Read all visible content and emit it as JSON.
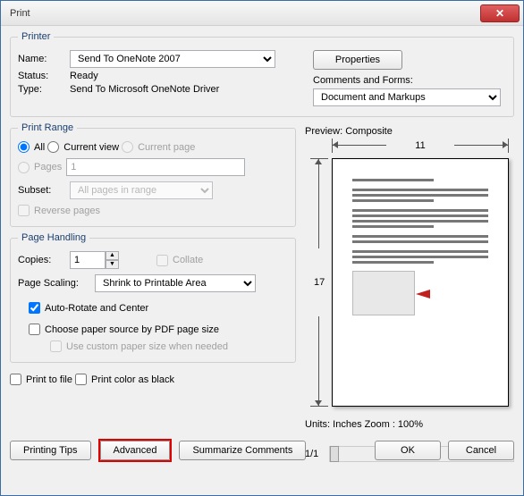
{
  "window": {
    "title": "Print"
  },
  "printer": {
    "legend": "Printer",
    "name_label": "Name:",
    "name_value": "Send To OneNote 2007",
    "properties_btn": "Properties",
    "status_label": "Status:",
    "status_value": "Ready",
    "type_label": "Type:",
    "type_value": "Send To Microsoft OneNote Driver",
    "comments_label": "Comments and Forms:",
    "comments_value": "Document and Markups"
  },
  "range": {
    "legend": "Print Range",
    "all": "All",
    "current_view": "Current view",
    "current_page": "Current page",
    "pages": "Pages",
    "pages_value": "1",
    "subset_label": "Subset:",
    "subset_value": "All pages in range",
    "reverse": "Reverse pages"
  },
  "handling": {
    "legend": "Page Handling",
    "copies_label": "Copies:",
    "copies_value": "1",
    "collate": "Collate",
    "scaling_label": "Page Scaling:",
    "scaling_value": "Shrink to Printable Area",
    "auto_rotate": "Auto-Rotate and Center",
    "choose_paper": "Choose paper source by PDF page size",
    "custom_paper": "Use custom paper size when needed"
  },
  "misc": {
    "print_to_file": "Print to file",
    "print_black": "Print color as black"
  },
  "preview": {
    "title": "Preview: Composite",
    "width": "11",
    "height": "17",
    "units": "Units: Inches Zoom : 100%",
    "pager": "1/1"
  },
  "buttons": {
    "tips": "Printing Tips",
    "advanced": "Advanced",
    "summarize": "Summarize Comments",
    "ok": "OK",
    "cancel": "Cancel"
  }
}
